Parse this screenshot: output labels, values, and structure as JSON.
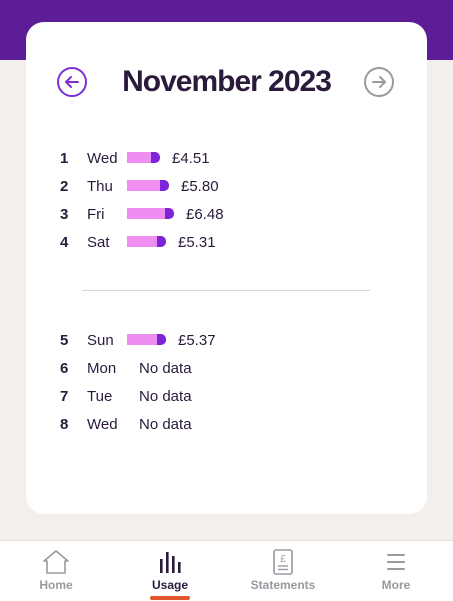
{
  "header": {
    "month_title": "November 2023"
  },
  "days_week_1": [
    {
      "num": "1",
      "day": "Wed",
      "amount": "£4.51",
      "value": 4.51
    },
    {
      "num": "2",
      "day": "Thu",
      "amount": "£5.80",
      "value": 5.8
    },
    {
      "num": "3",
      "day": "Fri",
      "amount": "£6.48",
      "value": 6.48
    },
    {
      "num": "4",
      "day": "Sat",
      "amount": "£5.31",
      "value": 5.31
    }
  ],
  "days_week_2": [
    {
      "num": "5",
      "day": "Sun",
      "amount": "£5.37",
      "value": 5.37
    },
    {
      "num": "6",
      "day": "Mon",
      "amount": "No data"
    },
    {
      "num": "7",
      "day": "Tue",
      "amount": "No data"
    },
    {
      "num": "8",
      "day": "Wed",
      "amount": "No data"
    }
  ],
  "tabs": [
    {
      "label": "Home",
      "icon": "home-icon",
      "active": false
    },
    {
      "label": "Usage",
      "icon": "usage-chart-icon",
      "active": true
    },
    {
      "label": "Statements",
      "icon": "statement-icon",
      "active": false
    },
    {
      "label": "More",
      "icon": "menu-icon",
      "active": false
    }
  ],
  "colors": {
    "brand_purple": "#5d1d96",
    "bar_pink": "#ee8ef0",
    "bar_purple": "#7c24d6",
    "accent_orange": "#e4572e"
  }
}
